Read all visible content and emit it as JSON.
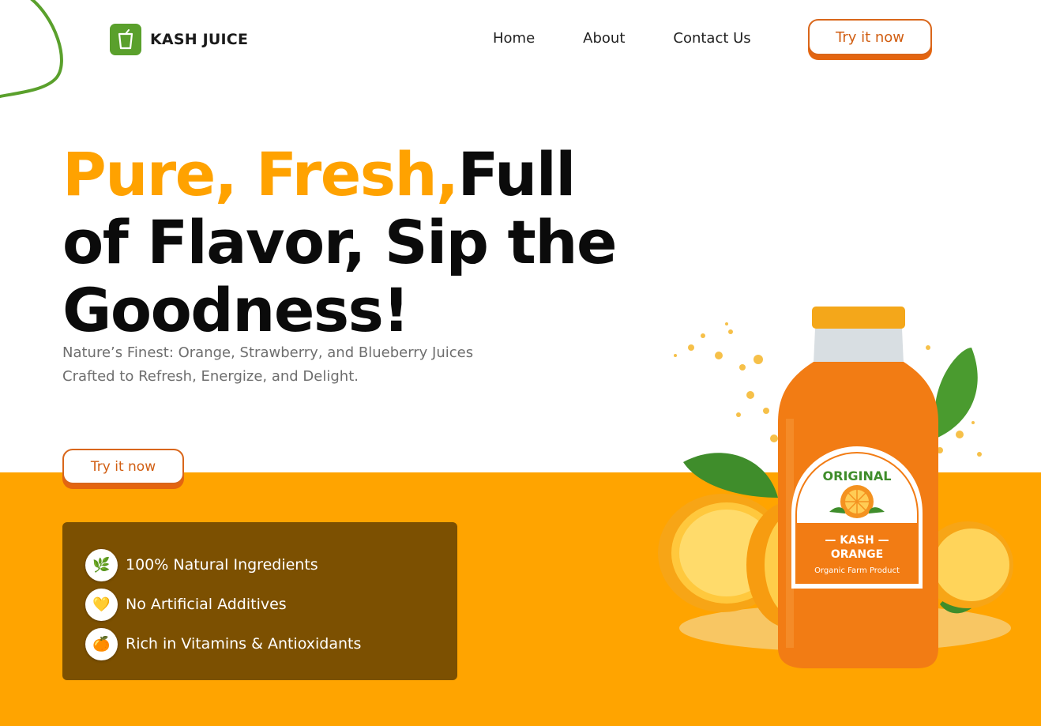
{
  "brand": {
    "name": "KASH JUICE",
    "logo_icon": "juice-cup-icon",
    "logo_color": "#5aa02c"
  },
  "nav": {
    "items": [
      "Home",
      "About",
      "Contact Us"
    ]
  },
  "header": {
    "cta_label": "Try it now"
  },
  "hero": {
    "headline_orange": "Pure, Fresh,",
    "headline_rest_line1": "Full",
    "headline_line2": "of Flavor, Sip the",
    "headline_line3": "Goodness!",
    "subtitle_line1": "Nature’s Finest: Orange, Strawberry, and Blueberry Juices",
    "subtitle_line2": "Crafted to Refresh, Energize, and Delight.",
    "cta_label": "Try it now"
  },
  "features": [
    {
      "icon": "herb-icon",
      "glyph": "🌿",
      "label": "100% Natural Ingredients"
    },
    {
      "icon": "heart-icon",
      "glyph": "💛",
      "label": "No Artificial Additives"
    },
    {
      "icon": "orange-icon",
      "glyph": "🍊",
      "label": "Rich in Vitamins & Antioxidants"
    }
  ],
  "product": {
    "label_top": "ORIGINAL",
    "label_brand": "— KASH —",
    "label_flavor": "ORANGE",
    "label_tag": "Organic Farm Product"
  },
  "colors": {
    "accent_orange": "#ffa400",
    "headline_orange": "#ffa200",
    "button_border": "#d9661a",
    "feature_panel": "#7c5001",
    "deco_green": "#5aa02c"
  }
}
